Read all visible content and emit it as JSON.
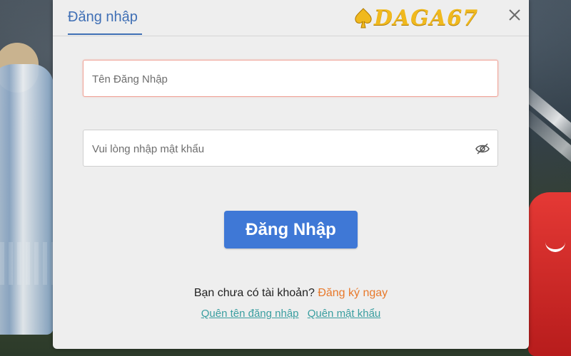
{
  "dialog": {
    "tab_title": "Đăng nhập",
    "logo_text": "DAGA67",
    "close_icon": "close-icon"
  },
  "form": {
    "username_placeholder": "Tên Đăng Nhập",
    "username_value": "",
    "password_placeholder": "Vui lòng nhập mật khẩu",
    "password_value": "",
    "password_toggle_icon": "eye-off-icon",
    "submit_label": "Đăng Nhập"
  },
  "footer": {
    "no_account_text": "Bạn chưa có tài khoản?",
    "signup_link": "Đăng ký ngay",
    "forgot_username_link": "Quên tên đăng nhập",
    "forgot_password_link": "Quên mật khẩu"
  },
  "colors": {
    "accent": "#3f78d6",
    "tab_blue": "#3f6fb5",
    "signup_orange": "#e8792b",
    "link_teal": "#3a9ea0",
    "logo_gold": "#f0b91e"
  }
}
